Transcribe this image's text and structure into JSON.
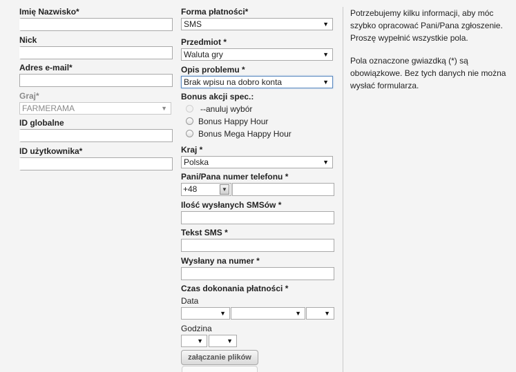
{
  "left": {
    "full_name_label": "Imię Nazwisko*",
    "nick_label": "Nick",
    "email_label": "Adres e-mail*",
    "game_label": "Graj*",
    "game_value": "FARMERAMA",
    "global_id_label": "ID globalne",
    "user_id_label": "ID użytkownika*"
  },
  "middle": {
    "payment_label": "Forma płatności*",
    "payment_value": "SMS",
    "subject_label": "Przedmiot *",
    "subject_value": "Waluta gry",
    "problem_label": "Opis problemu *",
    "problem_value": "Brak wpisu na dobro konta",
    "bonus_label": "Bonus akcji spec.:",
    "bonus_options": [
      "--anuluj wybór",
      "Bonus Happy Hour",
      "Bonus Mega Happy Hour"
    ],
    "country_label": "Kraj *",
    "country_value": "Polska",
    "phone_label": "Pani/Pana numer telefonu *",
    "phone_prefix": "+48",
    "sms_count_label": "Ilość wysłanych SMSów *",
    "sms_text_label": "Tekst SMS *",
    "sent_to_label": "Wysłany na numer *",
    "payment_time_label": "Czas dokonania płatności *",
    "date_label": "Data",
    "hour_label": "Godzina",
    "attach_button": "załączanie plików"
  },
  "info": {
    "paragraph1": "Potrzebujemy kilku informacji, aby móc szybko opracować Pani/Pana zgłoszenie. Proszę wypełnić wszystkie pola.",
    "paragraph2": "Pola oznaczone gwiazdką (*) są obowiązkowe. Bez tych danych nie można wysłać formularza."
  },
  "icons": {
    "dropdown": "chevron-down-icon",
    "radio": "radio-button"
  }
}
